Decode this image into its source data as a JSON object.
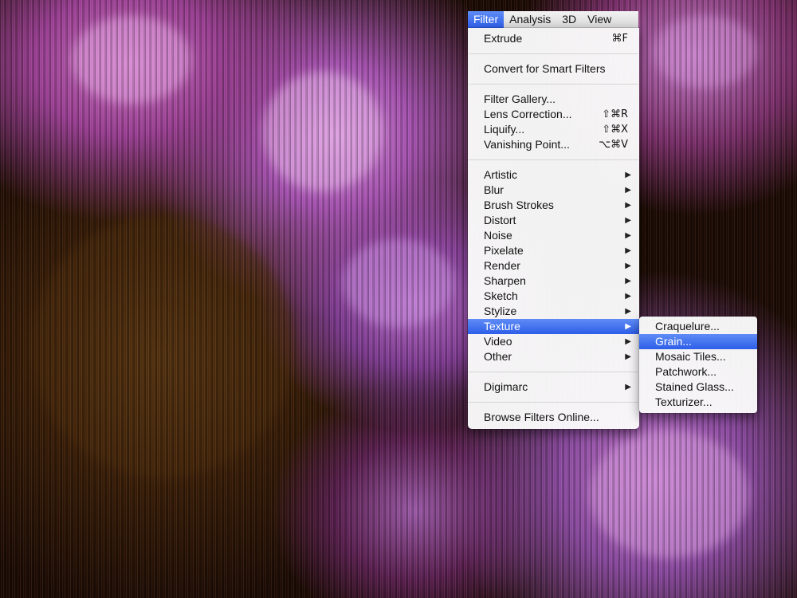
{
  "menubar": {
    "items": [
      {
        "label": "Filter",
        "active": true
      },
      {
        "label": "Analysis",
        "active": false
      },
      {
        "label": "3D",
        "active": false
      },
      {
        "label": "View",
        "active": false
      }
    ]
  },
  "filter_menu": {
    "extrude": {
      "label": "Extrude",
      "shortcut": "⌘F"
    },
    "convert_smart": {
      "label": "Convert for Smart Filters"
    },
    "filter_gallery": {
      "label": "Filter Gallery..."
    },
    "lens_correction": {
      "label": "Lens Correction...",
      "shortcut": "⇧⌘R"
    },
    "liquify": {
      "label": "Liquify...",
      "shortcut": "⇧⌘X"
    },
    "vanishing_point": {
      "label": "Vanishing Point...",
      "shortcut": "⌥⌘V"
    },
    "submenus": [
      {
        "label": "Artistic",
        "arrow": "▶"
      },
      {
        "label": "Blur",
        "arrow": "▶"
      },
      {
        "label": "Brush Strokes",
        "arrow": "▶"
      },
      {
        "label": "Distort",
        "arrow": "▶"
      },
      {
        "label": "Noise",
        "arrow": "▶"
      },
      {
        "label": "Pixelate",
        "arrow": "▶"
      },
      {
        "label": "Render",
        "arrow": "▶"
      },
      {
        "label": "Sharpen",
        "arrow": "▶"
      },
      {
        "label": "Sketch",
        "arrow": "▶"
      },
      {
        "label": "Stylize",
        "arrow": "▶"
      },
      {
        "label": "Texture",
        "arrow": "▶",
        "highlighted": true
      },
      {
        "label": "Video",
        "arrow": "▶"
      },
      {
        "label": "Other",
        "arrow": "▶"
      }
    ],
    "digimarc": {
      "label": "Digimarc",
      "arrow": "▶"
    },
    "browse_online": {
      "label": "Browse Filters Online..."
    }
  },
  "texture_menu": {
    "items": [
      {
        "label": "Craquelure...",
        "highlighted": false
      },
      {
        "label": "Grain...",
        "highlighted": true
      },
      {
        "label": "Mosaic Tiles...",
        "highlighted": false
      },
      {
        "label": "Patchwork...",
        "highlighted": false
      },
      {
        "label": "Stained Glass...",
        "highlighted": false
      },
      {
        "label": "Texturizer...",
        "highlighted": false
      }
    ]
  },
  "colors": {
    "highlight": "#2d5ee9",
    "menu_bg": "#fafafa",
    "menu_text": "#111111"
  }
}
